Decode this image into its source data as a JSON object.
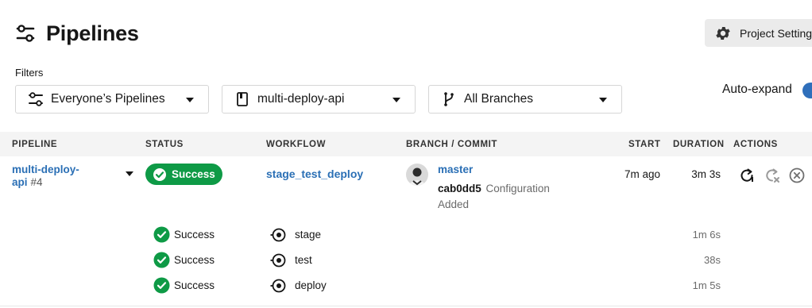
{
  "header": {
    "title": "Pipelines",
    "icon": "sliders-icon"
  },
  "project_settings": {
    "label": "Project Settings",
    "icon": "gear-icon"
  },
  "filters": {
    "label": "Filters",
    "pipelines_filter": {
      "value": "Everyone’s Pipelines",
      "icon": "users-filter-icon"
    },
    "project_filter": {
      "value": "multi-deploy-api",
      "icon": "bookmark-icon"
    },
    "branch_filter": {
      "value": "All Branches",
      "icon": "git-branch-icon"
    }
  },
  "auto_expand": {
    "label": "Auto-expand",
    "enabled": true
  },
  "table": {
    "columns": [
      "PIPELINE",
      "STATUS",
      "WORKFLOW",
      "BRANCH / COMMIT",
      "START",
      "DURATION",
      "ACTIONS"
    ]
  },
  "pipeline_row": {
    "name_line1": "multi-deploy-",
    "name_line2": "api",
    "number": "#4",
    "status": "Success",
    "workflow": "stage_test_deploy",
    "branch": "master",
    "commit_hash": "cab0dd5",
    "commit_message": "Configuration Added",
    "start": "7m ago",
    "duration": "3m 3s",
    "actions": [
      "rerun-icon",
      "rerun-failed-icon",
      "cancel-icon"
    ]
  },
  "jobs": [
    {
      "status": "Success",
      "name": "stage",
      "duration": "1m 6s"
    },
    {
      "status": "Success",
      "name": "test",
      "duration": "38s"
    },
    {
      "status": "Success",
      "name": "deploy",
      "duration": "1m 5s"
    }
  ],
  "colors": {
    "success": "#0e9a46",
    "link": "#2a6fb5",
    "toggle": "#2f6fbb",
    "header_bg": "#f4f4f4"
  }
}
